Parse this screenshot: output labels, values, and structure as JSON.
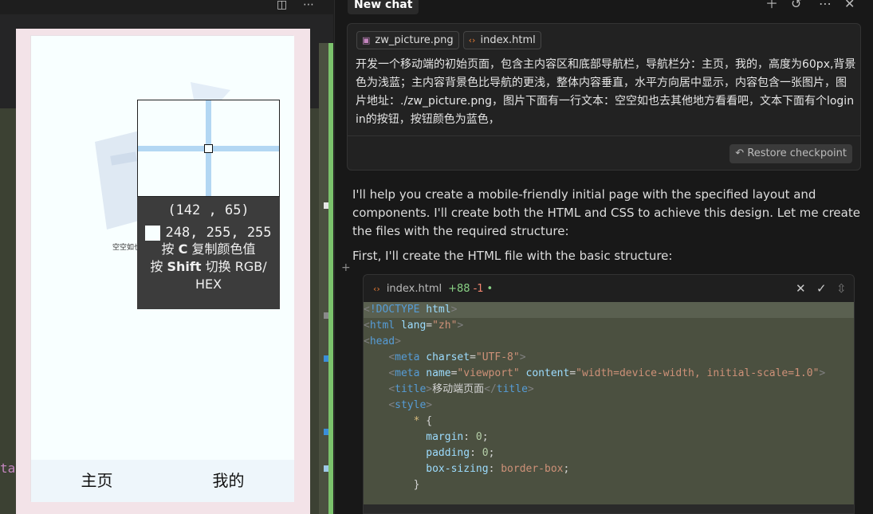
{
  "left": {
    "code_fragment": "ta"
  },
  "phone": {
    "nav_home": "主页",
    "nav_me": "我的",
    "content_text": "空空如也去其他地方看看吧"
  },
  "picker": {
    "coords": "(142 , 65)",
    "rgb": "248, 255, 255",
    "swatch_color": "#f8ffff",
    "hint_copy_pre": "按",
    "hint_copy_key": "C",
    "hint_copy_post": "复制颜色值",
    "hint_toggle_pre": "按",
    "hint_toggle_key": "Shift",
    "hint_toggle_post": "切换 RGB/",
    "hint_toggle_tail": "HEX"
  },
  "chat": {
    "title": "New chat",
    "attachments": [
      {
        "name": "zw_picture.png",
        "icon": "image-file-icon"
      },
      {
        "name": "index.html",
        "icon": "code-file-icon"
      }
    ],
    "prompt": "开发一个移动端的初始页面，包含主内容区和底部导航栏，导航栏分：主页，我的，高度为60px,背景色为浅蓝；主内容背景色比导航的更浅，整体内容垂直，水平方向居中显示，内容包含一张图片，图片地址：./zw_picture.png，图片下面有一行文本：空空如也去其他地方看看吧，文本下面有个login in的按钮，按钮颜色为蓝色，",
    "restore_label": "Restore checkpoint",
    "reply_1": "I'll help you create a mobile-friendly initial page with the specified layout and components. I'll create both the HTML and CSS to achieve this design. Let me create the files with the required structure:",
    "reply_2": "First, I'll create the HTML file with the basic structure:",
    "code_file": "index.html",
    "code_adds": "+88",
    "code_dels": "-1",
    "code_dot": "•"
  },
  "code": {
    "l1_doctype": "!DOCTYPE",
    "l1_html": "html",
    "l2_tag": "html",
    "l2_attr": "lang",
    "l2_val": "\"zh\"",
    "l3_tag": "head",
    "l4_tag": "meta",
    "l4_attr": "charset",
    "l4_val": "\"UTF-8\"",
    "l5_tag": "meta",
    "l5_attr1": "name",
    "l5_val1": "\"viewport\"",
    "l5_attr2": "content",
    "l5_val2": "\"width=device-width, initial-scale=1.0\"",
    "l6_tag": "title",
    "l6_text": "移动端页面",
    "l6_close": "title",
    "l7_tag": "style",
    "l8_sel": "*",
    "l8_brace": "{",
    "l9_prop": "margin",
    "l9_val": "0",
    "l10_prop": "padding",
    "l10_val": "0",
    "l11_prop": "box-sizing",
    "l11_val": "border-box",
    "l12_brace": "}"
  },
  "colors": {
    "accent_green": "#7bc26c",
    "code_bg": "#4b5040",
    "phone_bg": "#f8ffff",
    "nav_bg": "#eef6fb"
  }
}
